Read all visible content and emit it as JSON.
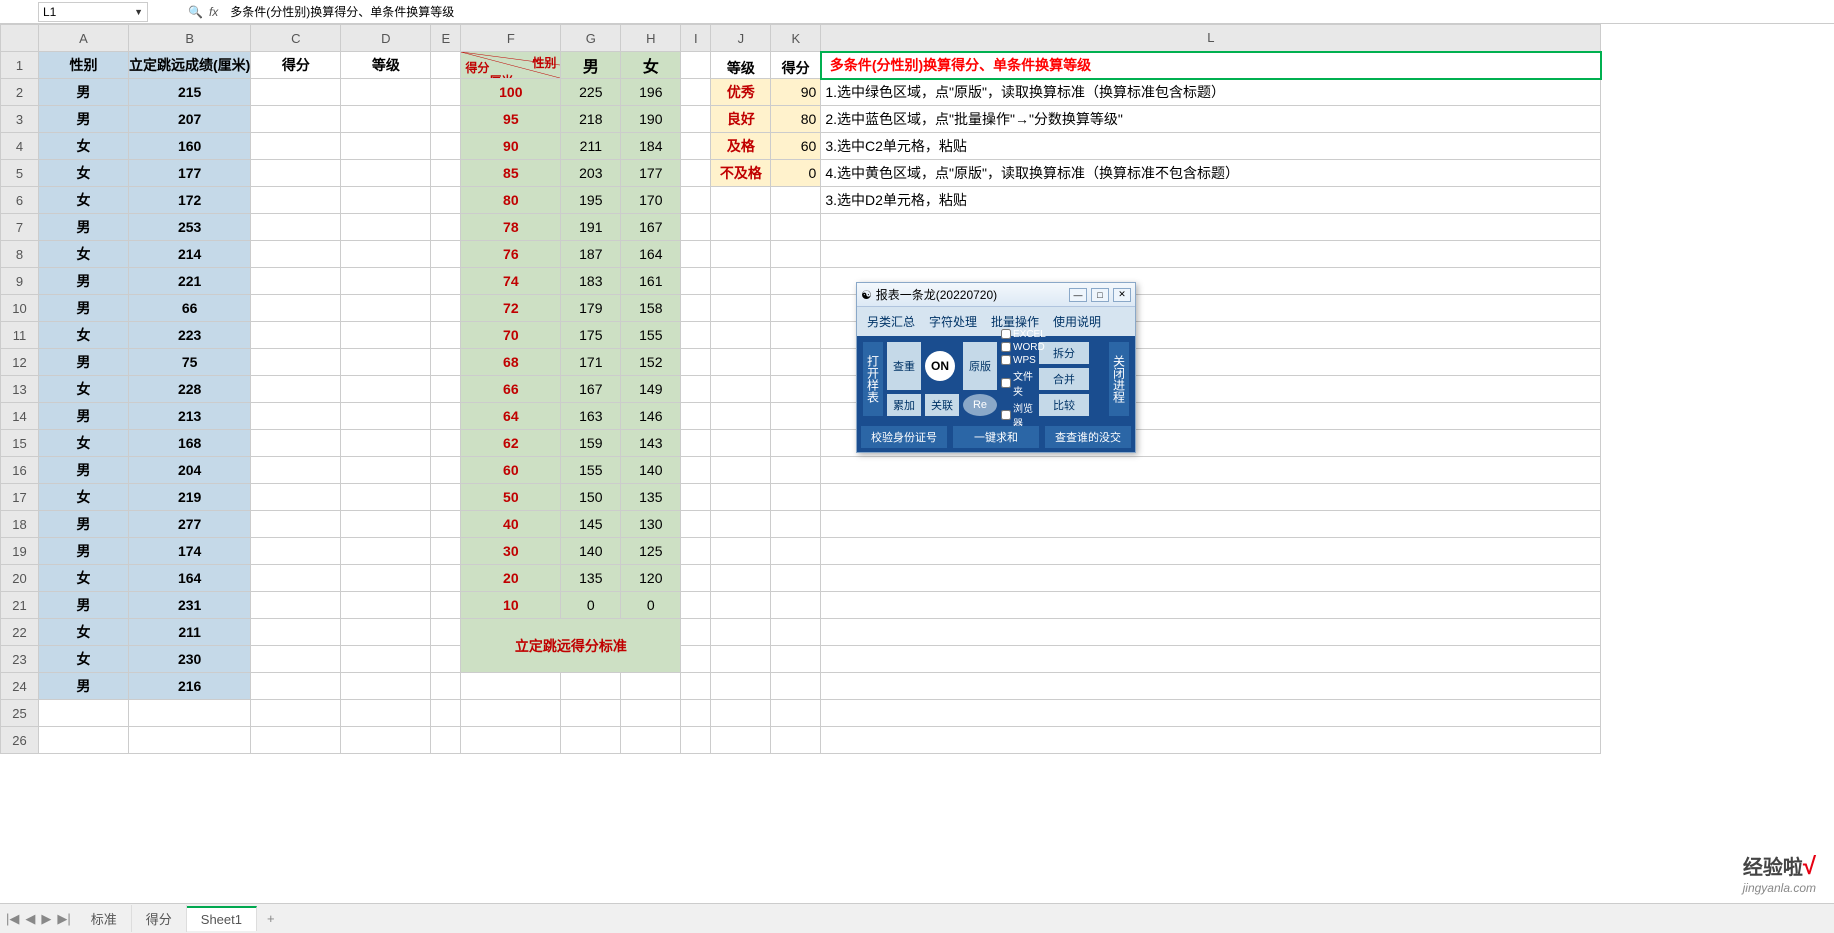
{
  "name_box": "L1",
  "formula_text": "多条件(分性别)换算得分、单条件换算等级",
  "columns": [
    "A",
    "B",
    "C",
    "D",
    "E",
    "F",
    "G",
    "H",
    "I",
    "J",
    "K",
    "L"
  ],
  "row_count": 26,
  "headers": {
    "A": "性别",
    "B": "立定跳远成绩(厘米)",
    "C": "得分",
    "D": "等级",
    "diag_top": "性别",
    "diag_mid": "厘米",
    "diag_bot": "得分",
    "G": "男",
    "H": "女",
    "J": "等级",
    "K": "得分"
  },
  "title_cell": "多条件(分性别)换算得分、单条件换算等级",
  "instructions": [
    "1.选中绿色区域，点\"原版\"，读取换算标准（换算标准包含标题）",
    "2.选中蓝色区域，点\"批量操作\"→\"分数换算等级\"",
    "3.选中C2单元格，粘贴",
    "4.选中黄色区域，点\"原版\"，读取换算标准（换算标准不包含标题）",
    "3.选中D2单元格，粘贴"
  ],
  "data_rows": [
    {
      "r": 2,
      "A": "男",
      "B": "215",
      "F": "100",
      "G": "225",
      "H": "196",
      "J": "优秀",
      "K": "90"
    },
    {
      "r": 3,
      "A": "男",
      "B": "207",
      "F": "95",
      "G": "218",
      "H": "190",
      "J": "良好",
      "K": "80"
    },
    {
      "r": 4,
      "A": "女",
      "B": "160",
      "F": "90",
      "G": "211",
      "H": "184",
      "J": "及格",
      "K": "60"
    },
    {
      "r": 5,
      "A": "女",
      "B": "177",
      "F": "85",
      "G": "203",
      "H": "177",
      "J": "不及格",
      "K": "0"
    },
    {
      "r": 6,
      "A": "女",
      "B": "172",
      "F": "80",
      "G": "195",
      "H": "170"
    },
    {
      "r": 7,
      "A": "男",
      "B": "253",
      "F": "78",
      "G": "191",
      "H": "167"
    },
    {
      "r": 8,
      "A": "女",
      "B": "214",
      "F": "76",
      "G": "187",
      "H": "164"
    },
    {
      "r": 9,
      "A": "男",
      "B": "221",
      "F": "74",
      "G": "183",
      "H": "161"
    },
    {
      "r": 10,
      "A": "男",
      "B": "66",
      "F": "72",
      "G": "179",
      "H": "158"
    },
    {
      "r": 11,
      "A": "女",
      "B": "223",
      "F": "70",
      "G": "175",
      "H": "155"
    },
    {
      "r": 12,
      "A": "男",
      "B": "75",
      "F": "68",
      "G": "171",
      "H": "152"
    },
    {
      "r": 13,
      "A": "女",
      "B": "228",
      "F": "66",
      "G": "167",
      "H": "149"
    },
    {
      "r": 14,
      "A": "男",
      "B": "213",
      "F": "64",
      "G": "163",
      "H": "146"
    },
    {
      "r": 15,
      "A": "女",
      "B": "168",
      "F": "62",
      "G": "159",
      "H": "143"
    },
    {
      "r": 16,
      "A": "男",
      "B": "204",
      "F": "60",
      "G": "155",
      "H": "140"
    },
    {
      "r": 17,
      "A": "女",
      "B": "219",
      "F": "50",
      "G": "150",
      "H": "135"
    },
    {
      "r": 18,
      "A": "男",
      "B": "277",
      "F": "40",
      "G": "145",
      "H": "130"
    },
    {
      "r": 19,
      "A": "男",
      "B": "174",
      "F": "30",
      "G": "140",
      "H": "125"
    },
    {
      "r": 20,
      "A": "女",
      "B": "164",
      "F": "20",
      "G": "135",
      "H": "120"
    },
    {
      "r": 21,
      "A": "男",
      "B": "231",
      "F": "10",
      "G": "0",
      "H": "0"
    },
    {
      "r": 22,
      "A": "女",
      "B": "211"
    },
    {
      "r": 23,
      "A": "女",
      "B": "230"
    },
    {
      "r": 24,
      "A": "男",
      "B": "216"
    }
  ],
  "standard_title": "立定跳远得分标准",
  "tool": {
    "title": "报表一条龙(20220720)",
    "menu": [
      "另类汇总",
      "字符处理",
      "批量操作",
      "使用说明"
    ],
    "left_btn": "打开样表",
    "right_btn": "关闭进程",
    "buttons": {
      "split": "拆分",
      "merge": "合并",
      "sum": "累加",
      "dup": "查重",
      "link": "关联",
      "on": "ON",
      "re": "Re",
      "orig": "原版",
      "comp": "比较"
    },
    "checks": [
      "EXCEL",
      "WORD",
      "WPS",
      "文件夹",
      "浏览器"
    ],
    "footer": [
      "校验身份证号",
      "一键求和",
      "查查谁的没交"
    ]
  },
  "tabs": {
    "list": [
      "标准",
      "得分",
      "Sheet1"
    ],
    "active": "Sheet1"
  },
  "watermark": {
    "text": "经验啦",
    "url": "jingyanla.com"
  }
}
